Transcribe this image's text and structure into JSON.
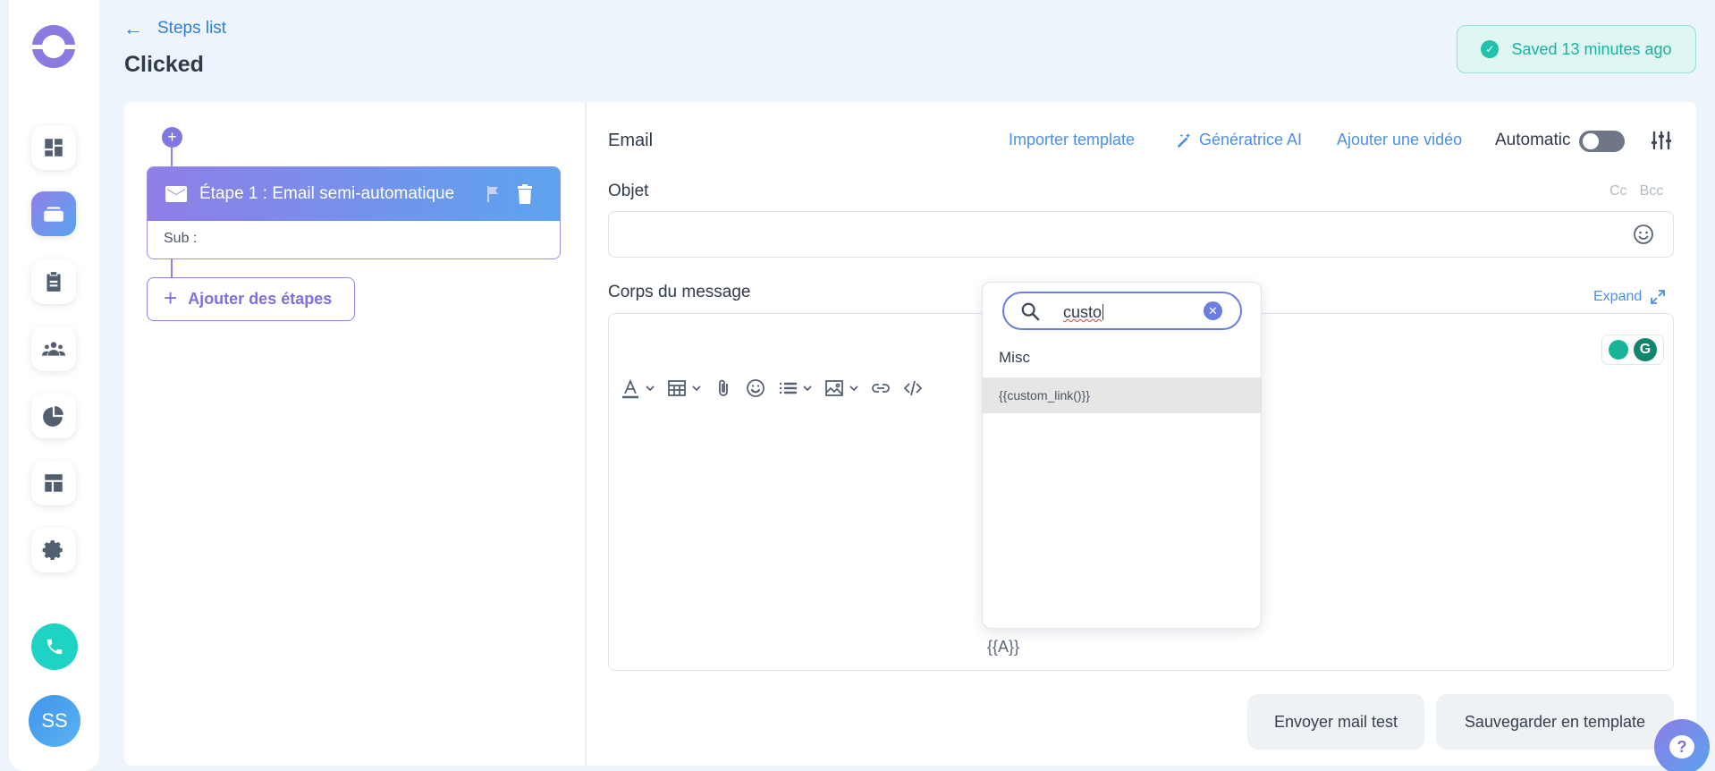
{
  "header": {
    "back_label": "Steps list",
    "title": "Clicked",
    "saved_status": "Saved 13 minutes ago"
  },
  "sidebar": {
    "icons": [
      "dashboard-icon",
      "campaign-icon",
      "clipboard-icon",
      "team-icon",
      "pie-chart-icon",
      "layout-icon",
      "gear-icon"
    ],
    "active_index": 1,
    "avatar_initials": "SS"
  },
  "steps": {
    "step1_title": "Étape 1 : Email semi-automatique",
    "step1_sub": "Sub :",
    "add_label": "Ajouter des étapes"
  },
  "editor": {
    "section_label": "Email",
    "import_template": "Importer template",
    "ai_generator": "Génératrice AI",
    "add_video": "Ajouter une vidéo",
    "automatic_label": "Automatic",
    "automatic_on": false,
    "subject_label": "Objet",
    "cc": "Cc",
    "bcc": "Bcc",
    "subject_value": "",
    "body_label": "Corps du message",
    "expand_label": "Expand",
    "body_token": "{{A}}"
  },
  "variable_dropdown": {
    "search_value": "custo",
    "group_label": "Misc",
    "items": [
      "{{custom_link()}}"
    ]
  },
  "actions": {
    "send_test": "Envoyer mail test",
    "save_template": "Sauvegarder en template"
  },
  "colors": {
    "accent_purple": "#8f7ee6",
    "accent_blue": "#5da4ef",
    "link_blue": "#4d8fe3",
    "success_teal": "#16b3a0"
  }
}
